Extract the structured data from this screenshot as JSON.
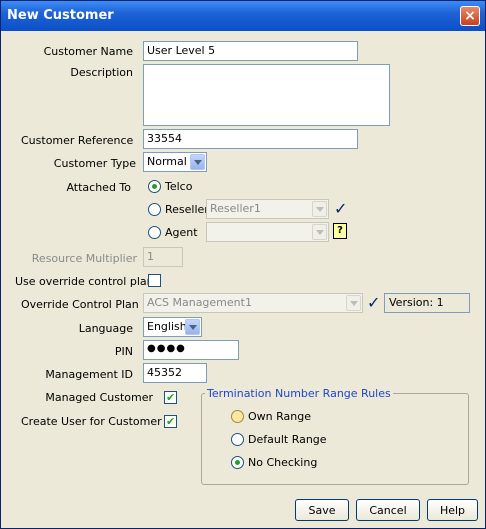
{
  "window": {
    "title": "New Customer"
  },
  "form": {
    "customer_name": {
      "label": "Customer Name",
      "value": "User Level 5"
    },
    "description": {
      "label": "Description",
      "value": ""
    },
    "customer_reference": {
      "label": "Customer Reference",
      "value": "33554"
    },
    "customer_type": {
      "label": "Customer Type",
      "value": "Normal"
    },
    "attached_to": {
      "label": "Attached To",
      "options": [
        {
          "label": "Telco",
          "checked": true
        },
        {
          "label": "Reseller",
          "checked": false,
          "select_value": "Reseller1"
        },
        {
          "label": "Agent",
          "checked": false,
          "select_value": ""
        }
      ]
    },
    "resource_multiplier": {
      "label": "Resource Multiplier",
      "value": "1"
    },
    "use_override": {
      "label": "Use override control plan",
      "checked": false
    },
    "override_control_plan": {
      "label": "Override Control Plan",
      "value": "ACS Management1",
      "version": "Version: 1"
    },
    "language": {
      "label": "Language",
      "value": "English"
    },
    "pin": {
      "label": "PIN",
      "value": "●●●●"
    },
    "management_id": {
      "label": "Management ID",
      "value": "45352"
    },
    "managed_customer": {
      "label": "Managed Customer",
      "checked": true
    },
    "create_user": {
      "label": "Create User for Customer",
      "checked": true
    }
  },
  "termination_rules": {
    "title": "Termination Number Range Rules",
    "options": [
      {
        "label": "Own Range",
        "checked": false
      },
      {
        "label": "Default Range",
        "checked": false
      },
      {
        "label": "No Checking",
        "checked": true
      }
    ]
  },
  "buttons": {
    "save": "Save",
    "cancel": "Cancel",
    "help": "Help"
  },
  "icons": {
    "close": "×",
    "help": "?",
    "check": "✓",
    "checkbox_mark": "✔"
  }
}
